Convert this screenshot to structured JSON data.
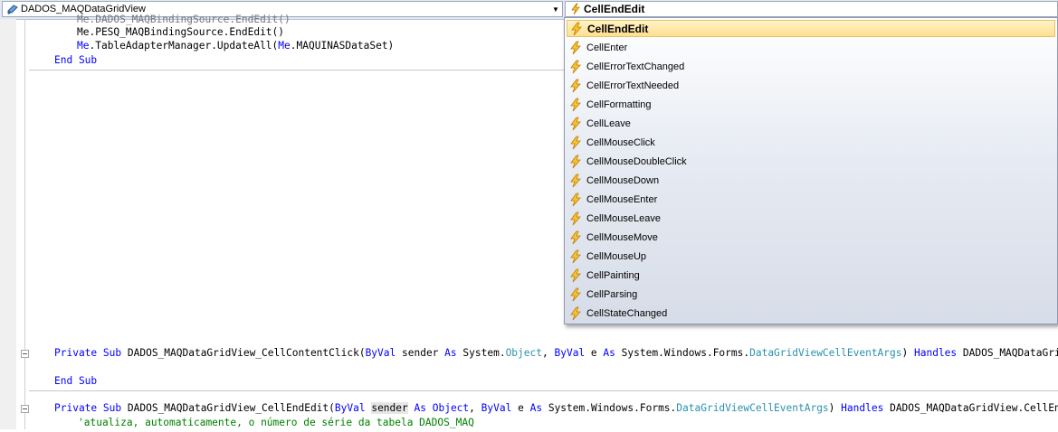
{
  "navbar": {
    "class_combo": "DADOS_MAQDataGridView",
    "method_combo": "CellEndEdit"
  },
  "code": {
    "lines": {
      "l0": "Me.DADOS_MAQBindingSource.EndEdit()",
      "l1": "Me.PESQ_MAQBindingSource.EndEdit()",
      "l2a": "Me",
      "l2b": ".TableAdapterManager.UpdateAll(",
      "l2c": "Me",
      "l2d": ".MAQUINASDataSet)",
      "l3": "End Sub"
    },
    "sub1": {
      "private": "Private",
      "sub": "Sub",
      "name": "DADOS_MAQDataGridView_CellContentClick(",
      "byval1": "ByVal",
      "p1": "sender",
      "as1": "As",
      "ns1": "System.",
      "t1": "Object",
      "comma": ",",
      "byval2": "ByVal",
      "p2": "e",
      "as2": "As",
      "ns2": "System.Windows.Forms.",
      "t2": "DataGridViewCellEventArgs",
      "close": ")",
      "handles": "Handles",
      "rest": "DADOS_MAQDataGridView.",
      "end": "End Sub"
    },
    "sub2": {
      "private": "Private",
      "sub": "Sub",
      "name": "DADOS_MAQDataGridView_CellEndEdit(",
      "byval1": "ByVal",
      "p1": "sender",
      "as1": "As",
      "t1": "Object",
      "comma": ",",
      "byval2": "ByVal",
      "p2": "e",
      "as2": "As",
      "ns2": "System.Windows.Forms.",
      "t2": "DataGridViewCellEventArgs",
      "close": ")",
      "handles": "Handles",
      "rest": "DADOS_MAQDataGridView.CellEndEdit",
      "comment": "'atualiza, automaticamente, o número de série da tabela DADOS_MAQ"
    }
  },
  "dropdown": {
    "items": [
      "CellEndEdit",
      "CellEnter",
      "CellErrorTextChanged",
      "CellErrorTextNeeded",
      "CellFormatting",
      "CellLeave",
      "CellMouseClick",
      "CellMouseDoubleClick",
      "CellMouseDown",
      "CellMouseEnter",
      "CellMouseLeave",
      "CellMouseMove",
      "CellMouseUp",
      "CellPainting",
      "CellParsing",
      "CellStateChanged"
    ],
    "selected_index": 0
  },
  "colors": {
    "keyword": "#0000ff",
    "type": "#2b91af",
    "comment": "#008000",
    "selection": "#ffe08f"
  }
}
